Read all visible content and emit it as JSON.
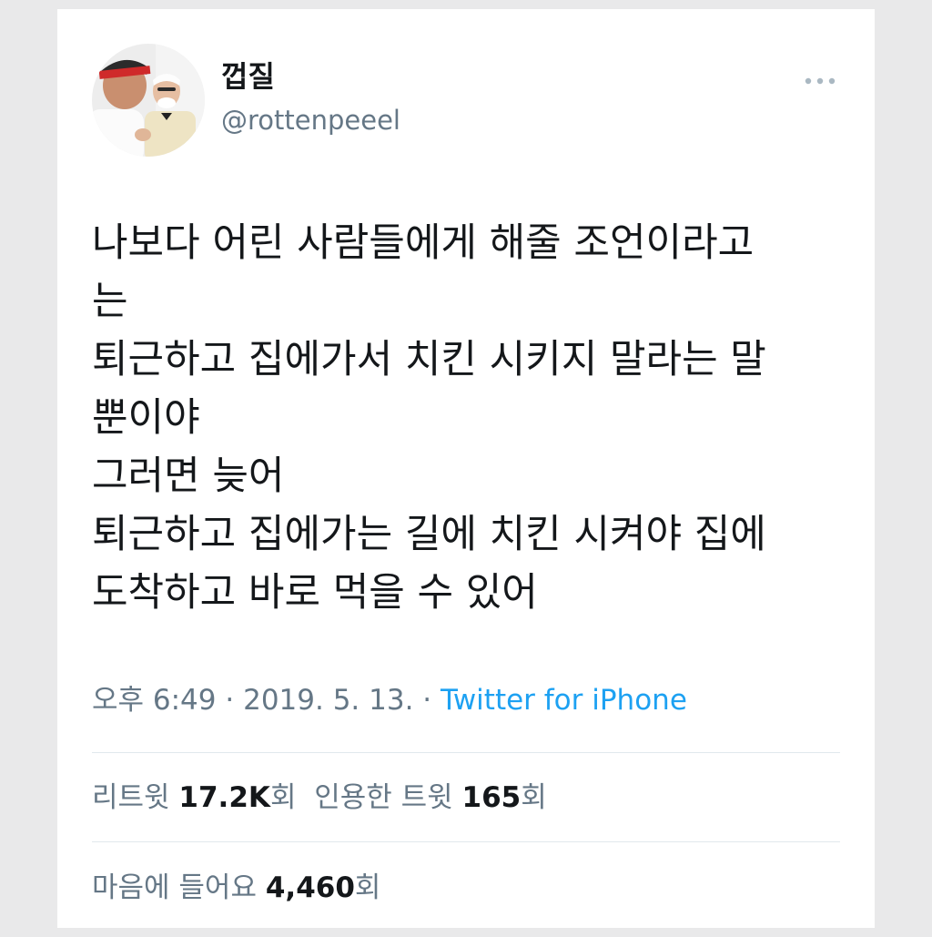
{
  "tweet": {
    "author": {
      "display_name": "껍질",
      "handle": "@rottenpeeel"
    },
    "text_lines": [
      "나보다 어린 사람들에게 해줄 조언이라고",
      "는",
      "퇴근하고 집에가서 치킨 시키지 말라는 말",
      "뿐이야",
      "그러면 늦어",
      "퇴근하고 집에가는 길에 치킨 시켜야 집에",
      "도착하고 바로 먹을 수 있어"
    ],
    "time": "오후 6:49",
    "date": "2019. 5. 13.",
    "separator": "·",
    "source": "Twitter for iPhone",
    "stats": {
      "retweets_label": "리트윗",
      "retweets_count": "17.2K",
      "retweets_unit": "회",
      "quotes_label": "인용한 트윗",
      "quotes_count": "165",
      "quotes_unit": "회",
      "likes_label": "마음에 들어요",
      "likes_count": "4,460",
      "likes_unit": "회"
    }
  },
  "colors": {
    "text_primary": "#14171a",
    "text_secondary": "#657786",
    "link": "#1da1f2",
    "divider": "#e1e8ed"
  },
  "icons": {
    "more": "more-horizontal-icon"
  }
}
